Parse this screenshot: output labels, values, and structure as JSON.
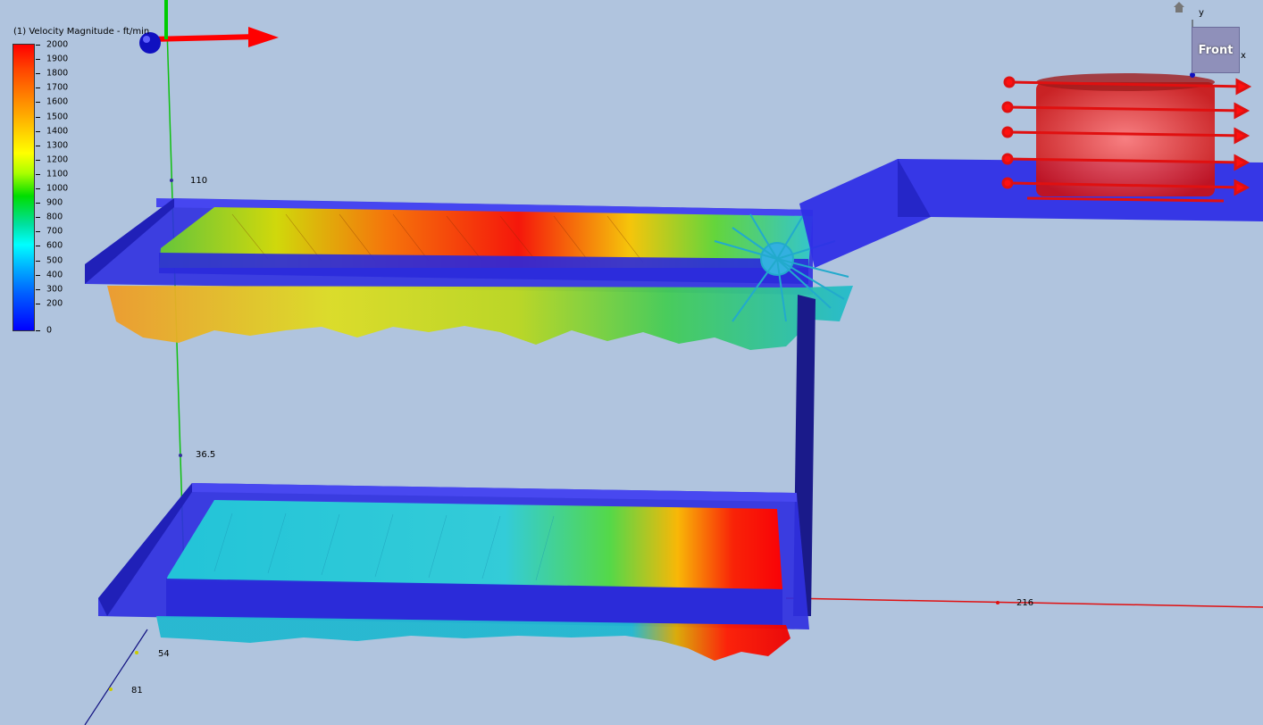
{
  "legend": {
    "title": "(1) Velocity Magnitude - ft/min",
    "ticks": [
      "2000",
      "1900",
      "1800",
      "1700",
      "1600",
      "1500",
      "1400",
      "1300",
      "1200",
      "1100",
      "1000",
      "900",
      "800",
      "700",
      "600",
      "500",
      "400",
      "300",
      "200",
      "0"
    ]
  },
  "axis_labels": {
    "y_110": "110",
    "y_36_5": "36.5",
    "x_216": "216",
    "z_54": "54",
    "z_81": "81"
  },
  "viewcube": {
    "face_label": "Front",
    "y_axis": "y",
    "x_axis": "x"
  },
  "icons": {
    "home": "home-icon",
    "triad": "coordinate-triad-icon"
  },
  "colors": {
    "background": "#b0c4de",
    "duct": "#2222e0",
    "high_velocity": "#ff0000",
    "low_velocity": "#0000ff",
    "x_axis": "#e01010",
    "y_axis": "#10c010",
    "z_axis": "#101080"
  }
}
